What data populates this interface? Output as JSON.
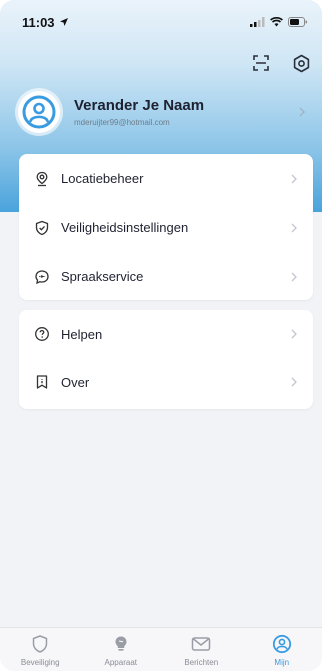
{
  "status_bar": {
    "time": "11:03"
  },
  "profile": {
    "name": "Verander Je Naam",
    "email": "mderuijter99@hotmail.com"
  },
  "menu_group_1": [
    {
      "label": "Locatiebeheer",
      "icon": "location-pin-icon"
    },
    {
      "label": "Veiligheidsinstellingen",
      "icon": "shield-check-icon"
    },
    {
      "label": "Spraakservice",
      "icon": "speech-bubble-icon"
    }
  ],
  "menu_group_2": [
    {
      "label": "Helpen",
      "icon": "help-circle-icon"
    },
    {
      "label": "Over",
      "icon": "bookmark-info-icon"
    }
  ],
  "tabbar": [
    {
      "label": "Beveiliging",
      "icon": "shield-icon",
      "active": false
    },
    {
      "label": "Apparaat",
      "icon": "bulb-icon",
      "active": false
    },
    {
      "label": "Berichten",
      "icon": "mail-icon",
      "active": false
    },
    {
      "label": "Mijn",
      "icon": "user-circle-icon",
      "active": true
    }
  ],
  "colors": {
    "accent": "#3a9be0",
    "header_gradient_bottom": "#4aa3dc",
    "background": "#f2f3f7"
  }
}
